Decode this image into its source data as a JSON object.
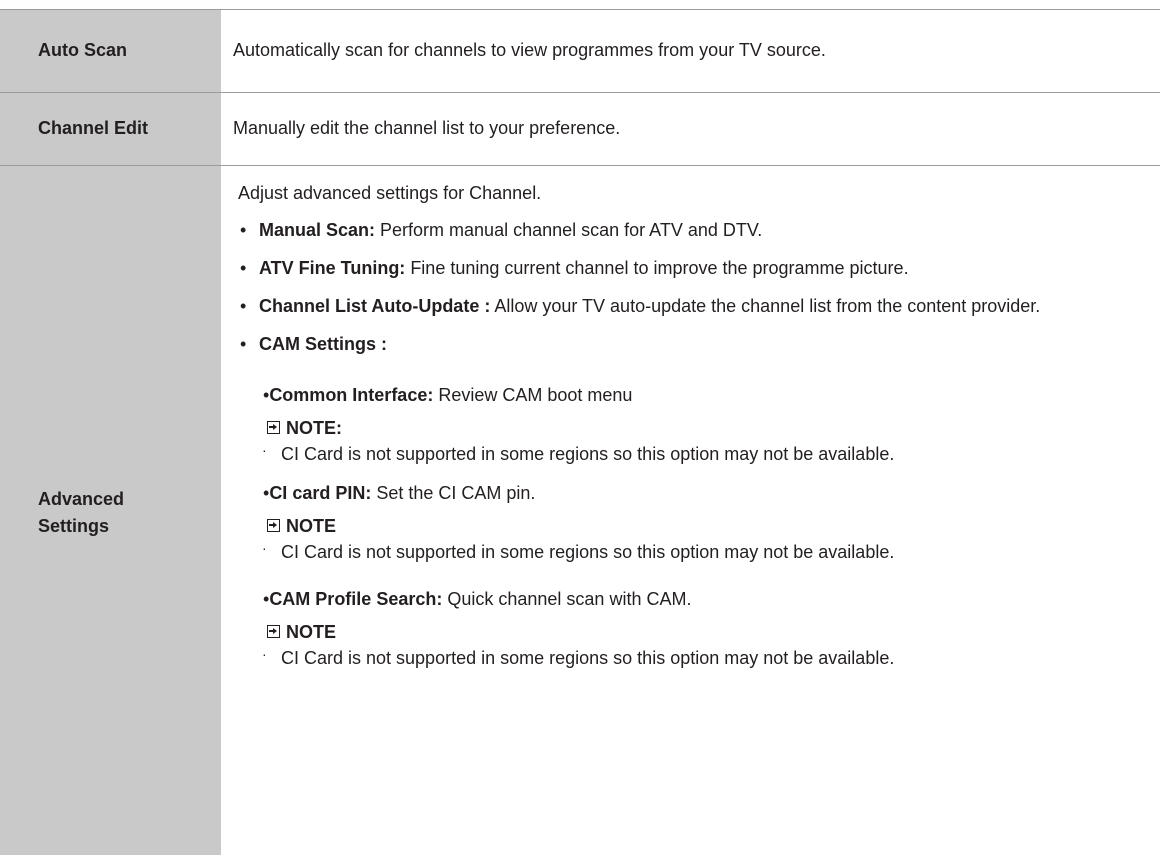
{
  "rows": [
    {
      "key": "Auto Scan",
      "desc": "Automatically scan for channels to view programmes from your TV source."
    },
    {
      "key": "Channel Edit",
      "desc": "Manually edit the channel list to your preference."
    }
  ],
  "advanced": {
    "key_line1": "Advanced",
    "key_line2": "Settings",
    "intro": "Adjust advanced settings for Channel.",
    "bullet_symbol": "•",
    "items": [
      {
        "term": "Manual Scan:",
        "text": " Perform manual channel scan for ATV and DTV."
      },
      {
        "term": "ATV Fine Tuning:",
        "text": " Fine tuning current channel to improve the programme picture."
      },
      {
        "term": "Channel List Auto-Update :",
        "text": " Allow your TV auto-update the channel list from the content provider."
      },
      {
        "term": "CAM Settings :",
        "text": ""
      }
    ],
    "cam": [
      {
        "term": "Common Interface:",
        "text": " Review CAM boot menu",
        "note_label": "NOTE:",
        "note_text": "CI Card is not supported in some regions so this option may not be available."
      },
      {
        "term": "CI card PIN:",
        "text": " Set the CI CAM pin.",
        "note_label": "NOTE",
        "note_text": "CI Card is not supported in some regions so this option may not be available."
      },
      {
        "term": "CAM Profile Search:",
        "text": " Quick channel scan with CAM.",
        "note_label": "NOTE",
        "note_text": "CI Card is not supported in some regions so this option may not be available."
      }
    ],
    "note_dot": "·",
    "note_icon": "arrow-into-box-icon"
  }
}
